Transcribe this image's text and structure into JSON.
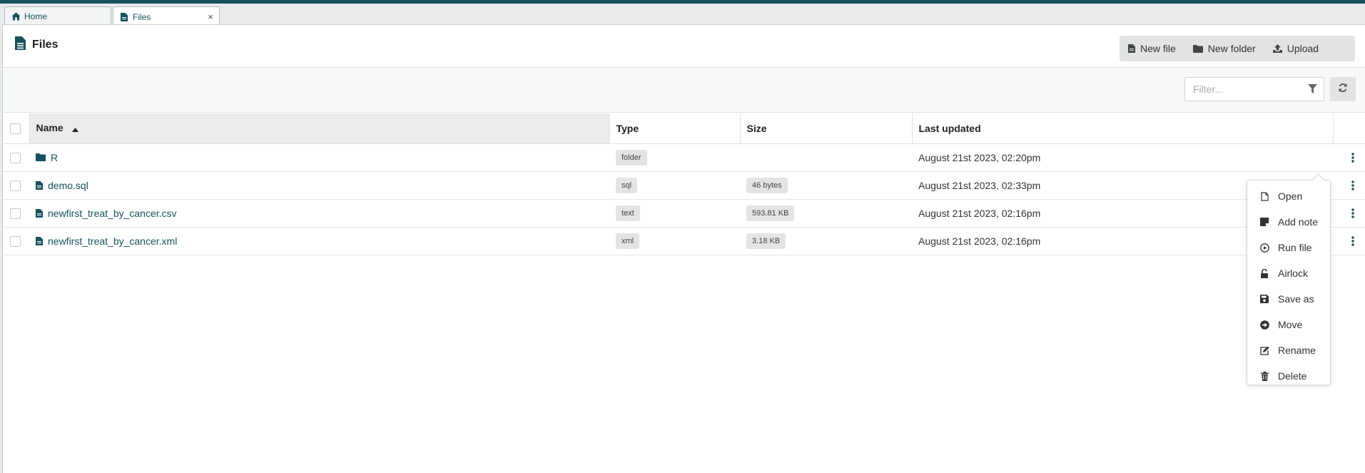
{
  "tabs": [
    {
      "label": "Home",
      "icon": "home-icon"
    },
    {
      "label": "Files",
      "icon": "file-icon",
      "close": "×"
    }
  ],
  "header": {
    "title": "Files",
    "buttons": {
      "new_file": "New file",
      "new_folder": "New folder",
      "upload": "Upload"
    }
  },
  "filter": {
    "placeholder": "Filter..."
  },
  "table": {
    "columns": {
      "name": "Name",
      "type": "Type",
      "size": "Size",
      "last_updated": "Last updated"
    },
    "rows": [
      {
        "name": "R",
        "icon": "folder-icon",
        "type": "folder",
        "size": "",
        "updated": "August 21st 2023, 02:20pm"
      },
      {
        "name": "demo.sql",
        "icon": "file-icon",
        "type": "sql",
        "size": "46 bytes",
        "updated": "August 21st 2023, 02:33pm"
      },
      {
        "name": "newfirst_treat_by_cancer.csv",
        "icon": "file-icon",
        "type": "text",
        "size": "593.81 KB",
        "updated": "August 21st 2023, 02:16pm"
      },
      {
        "name": "newfirst_treat_by_cancer.xml",
        "icon": "file-icon",
        "type": "xml",
        "size": "3.18 KB",
        "updated": "August 21st 2023, 02:16pm"
      }
    ]
  },
  "context_menu": {
    "items": [
      "Open",
      "Add note",
      "Run file",
      "Airlock",
      "Save as",
      "Move",
      "Rename",
      "Delete"
    ]
  },
  "colors": {
    "accent": "#15525e",
    "topbar": "#15525e"
  }
}
